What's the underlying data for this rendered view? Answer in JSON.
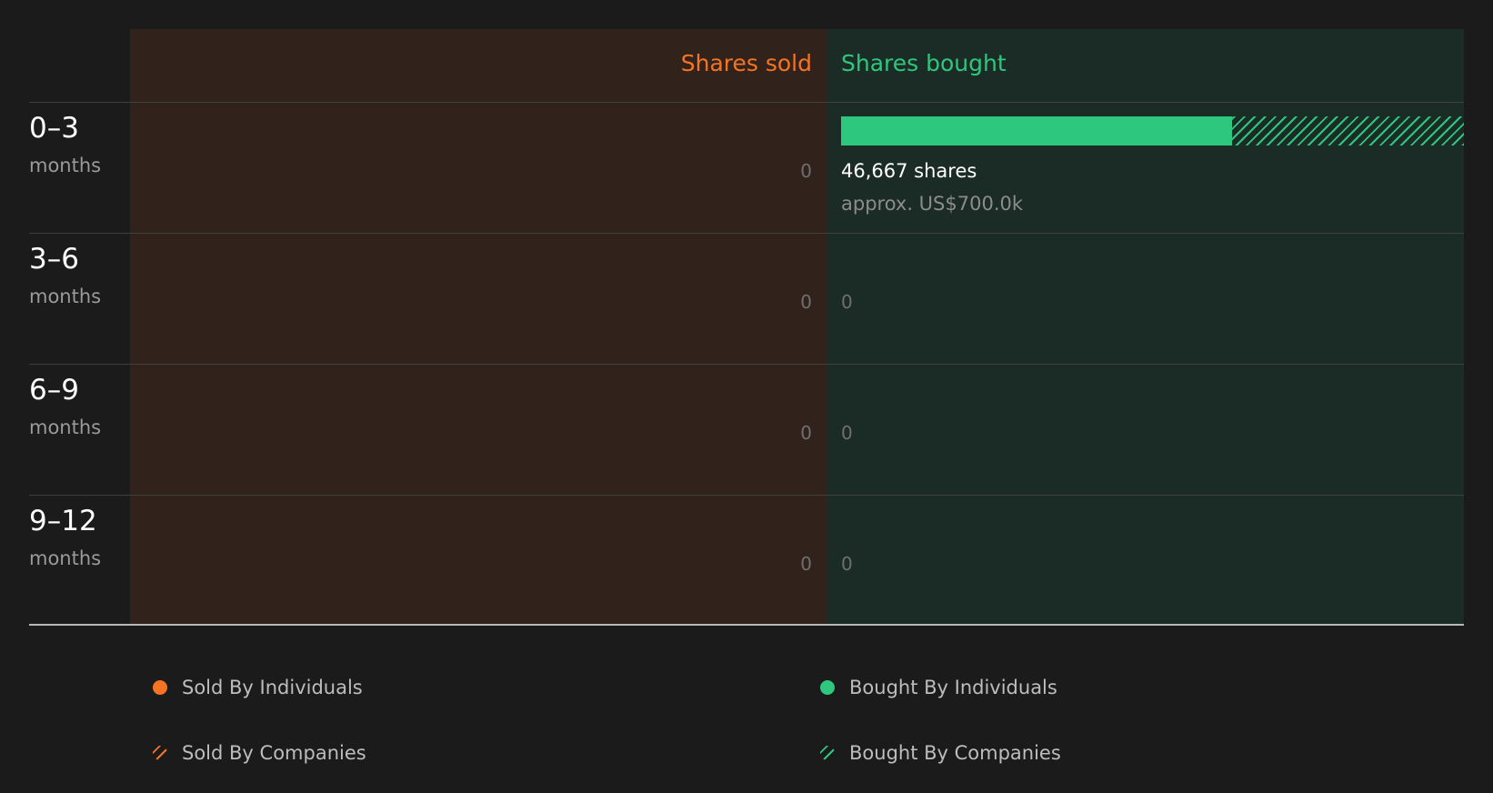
{
  "colors": {
    "sold": "#f57423",
    "bought": "#2ec77e"
  },
  "chart_data": {
    "type": "bar",
    "orientation": "horizontal",
    "layout": "diverging",
    "columns": {
      "sold": "Shares sold",
      "bought": "Shares bought"
    },
    "categories": [
      {
        "period": "0–3",
        "unit": "months"
      },
      {
        "period": "3–6",
        "unit": "months"
      },
      {
        "period": "6–9",
        "unit": "months"
      },
      {
        "period": "9–12",
        "unit": "months"
      }
    ],
    "series": [
      {
        "name": "Sold By Individuals",
        "side": "sold",
        "pattern": "solid",
        "values": [
          0,
          0,
          0,
          0
        ]
      },
      {
        "name": "Sold By Companies",
        "side": "sold",
        "pattern": "hatched",
        "values": [
          0,
          0,
          0,
          0
        ]
      },
      {
        "name": "Bought By Individuals",
        "side": "bought",
        "pattern": "solid",
        "values": [
          29300,
          0,
          0,
          0
        ]
      },
      {
        "name": "Bought By Companies",
        "side": "bought",
        "pattern": "hatched",
        "values": [
          17367,
          0,
          0,
          0
        ]
      }
    ],
    "sold_labels": [
      "0",
      "0",
      "0",
      "0"
    ],
    "bought_labels": [
      "46,667 shares",
      "0",
      "0",
      "0"
    ],
    "bought_value_labels": [
      "approx. US$700.0k",
      "",
      "",
      ""
    ],
    "legend_position": "bottom"
  }
}
